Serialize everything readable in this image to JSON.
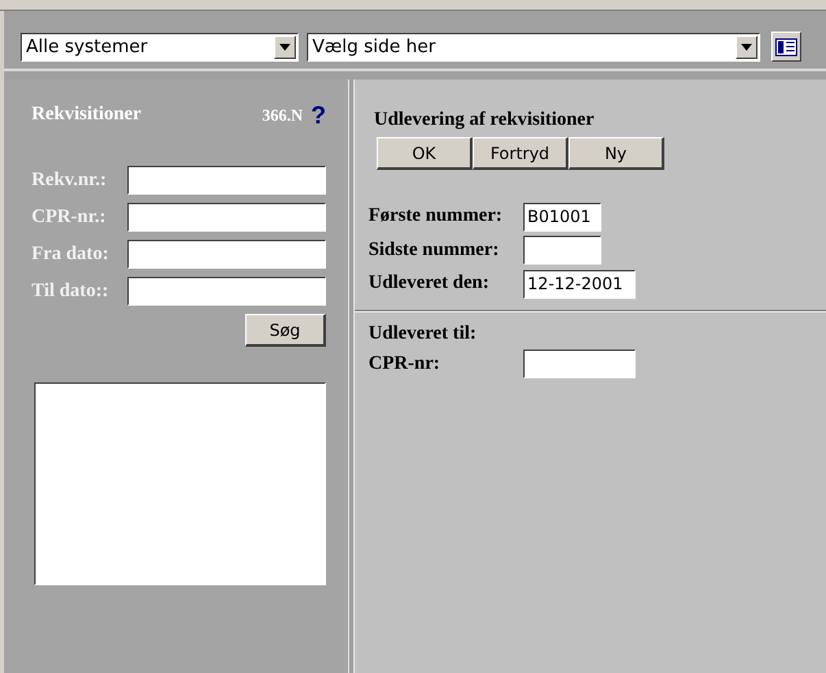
{
  "toolbar": {
    "system_select": {
      "value": "Alle systemer"
    },
    "page_select": {
      "value": "Vælg side her"
    }
  },
  "search_panel": {
    "title": "Rekvisitioner",
    "code": "366.N",
    "help": "?",
    "fields": [
      {
        "label": "Rekv.nr.:"
      },
      {
        "label": "CPR-nr.:"
      },
      {
        "label": "Fra dato:"
      },
      {
        "label": "Til dato::"
      }
    ],
    "search_button": "Søg"
  },
  "form": {
    "title": "Udlevering af rekvisitioner",
    "buttons": [
      "OK",
      "Fortryd",
      "Ny"
    ],
    "fields": [
      {
        "label": "Første nummer:",
        "value": "B01001"
      },
      {
        "label": "Sidste nummer:"
      },
      {
        "label": "Udleveret den:",
        "value": "12-12-2001"
      }
    ],
    "recipient_title": "Udleveret til:",
    "recipient_fields": [
      {
        "label": "CPR-nr:"
      }
    ]
  }
}
